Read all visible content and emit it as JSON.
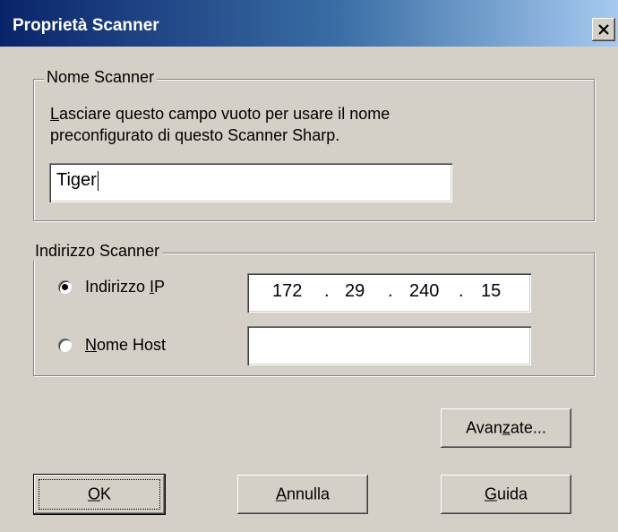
{
  "window": {
    "title": "Proprietà Scanner",
    "close_glyph": "close-icon"
  },
  "name_group": {
    "legend": "Nome Scanner",
    "description_line1": "Lasciare questo campo vuoto per usare il nome",
    "description_line2": "preconfigurato di questo Scanner Sharp.",
    "name_value": "Tiger"
  },
  "address_group": {
    "legend": "Indirizzo Scanner",
    "ip_option_label": "Indirizzo IP",
    "ip_option_selected": true,
    "host_option_label": "Nome Host",
    "host_option_selected": false,
    "ip_octets": [
      "172",
      "29",
      "240",
      "15"
    ],
    "ip_separator": ".",
    "host_value": ""
  },
  "buttons": {
    "advanced": "Avanzate...",
    "ok": "OK",
    "cancel": "Annulla",
    "help": "Guida"
  },
  "colors": {
    "titlebar_start": "#0a246a",
    "titlebar_end": "#a6caf0",
    "face": "#d4d0c8"
  }
}
